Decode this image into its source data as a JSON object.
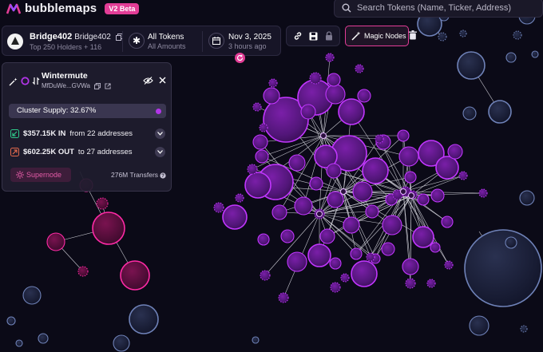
{
  "app": {
    "name": "bubblemaps",
    "badge": "V2 Beta"
  },
  "search": {
    "placeholder": "Search Tokens (Name, Ticker, Address)"
  },
  "token": {
    "name": "Bridge402",
    "symbol": "Bridge402",
    "subtitle": "Top 250 Holders + 116"
  },
  "filters": {
    "amount_title": "All Tokens",
    "amount_sub": "All Amounts",
    "date_title": "Nov 3, 2025",
    "date_sub": "3 hours ago"
  },
  "toolbar": {
    "magic_nodes_label": "Magic Nodes"
  },
  "wallet_panel": {
    "name": "Wintermute",
    "address": "MfDuWe...GVWa",
    "cluster_supply": "Cluster Supply: 32.67%",
    "inflow": {
      "amount": "$357.15K IN",
      "detail": "from 22 addresses"
    },
    "outflow": {
      "amount": "$602.25K OUT",
      "detail": "to 27 addresses"
    },
    "supernode_label": "Supernode",
    "transfers": "276M Transfers"
  },
  "colors": {
    "background": "#0b0a17",
    "accent": "#e23d96",
    "cluster": "#b235e8",
    "inflow": "#2fc98a",
    "outflow": "#e2694d",
    "neutral_bubble": "#8fa0c8"
  },
  "icons": [
    "search-icon",
    "copy-icon",
    "asterisk-icon",
    "calendar-icon",
    "refresh-icon",
    "link-icon",
    "save-icon",
    "lock-icon",
    "magic-wand-icon",
    "trash-icon",
    "wand-small-icon",
    "token-ring-icon",
    "external-link-icon",
    "eye-off-icon",
    "close-icon",
    "arrow-in-icon",
    "arrow-out-icon",
    "chevron-down-icon",
    "supernode-icon",
    "help-icon"
  ]
}
